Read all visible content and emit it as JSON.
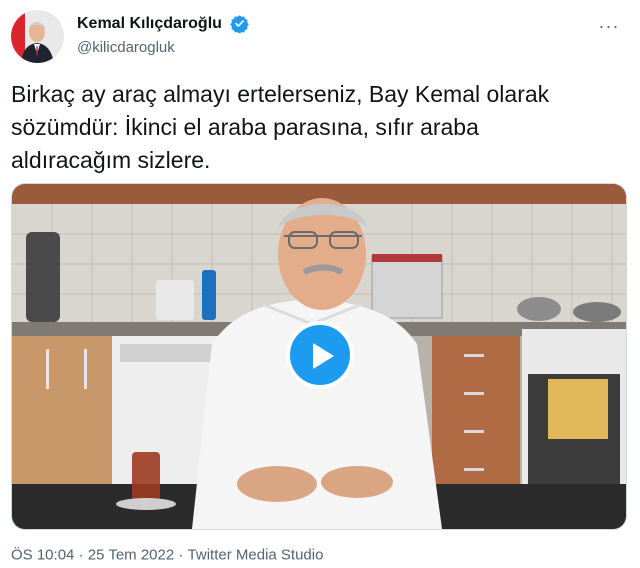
{
  "author": {
    "display_name": "Kemal Kılıçdaroğlu",
    "handle": "@kilicdarogluk"
  },
  "tweet": {
    "line1": "Birkaç ay araç almayı ertelerseniz, Bay Kemal olarak",
    "line2": "sözümdür: İkinci el araba parasına, sıfır araba",
    "line3": "aldıracağım sizlere."
  },
  "meta": {
    "time": "ÖS 10:04",
    "sep1": "·",
    "date": "25 Tem 2022",
    "sep2": "·",
    "source": "Twitter Media Studio"
  },
  "icons": {
    "verified": "verified-badge-icon",
    "more": "more-options-icon",
    "play": "play-icon"
  },
  "colors": {
    "accent": "#1d9bf0",
    "secondary_text": "#536471"
  }
}
